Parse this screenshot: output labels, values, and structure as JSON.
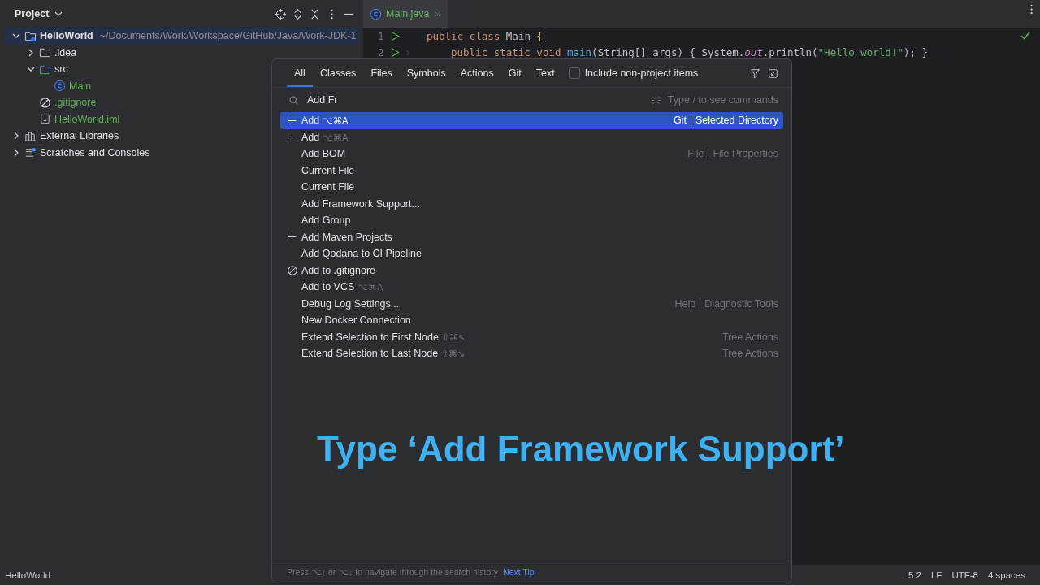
{
  "project_panel": {
    "title": "Project",
    "tree": [
      {
        "label": "HelloWorld",
        "detail": "~/Documents/Work/Workspace/GitHub/Java/Work-JDK-1",
        "kind": "module",
        "expanded": true,
        "selected": true,
        "added": false,
        "children": [
          {
            "label": ".idea",
            "kind": "folder",
            "expanded": false,
            "selected": false,
            "added": false
          },
          {
            "label": "src",
            "kind": "source",
            "expanded": true,
            "selected": false,
            "added": false,
            "children": [
              {
                "label": "Main",
                "kind": "class",
                "selected": false,
                "added": true
              }
            ]
          },
          {
            "label": ".gitignore",
            "kind": "ignore",
            "selected": false,
            "added": true
          },
          {
            "label": "HelloWorld.iml",
            "kind": "file",
            "selected": false,
            "added": true
          }
        ]
      },
      {
        "label": "External Libraries",
        "kind": "library",
        "expanded": false,
        "selected": false,
        "added": false
      },
      {
        "label": "Scratches and Consoles",
        "kind": "scratch",
        "expanded": false,
        "selected": false,
        "added": false
      }
    ]
  },
  "editor": {
    "tab": {
      "label": "Main.java",
      "selected": true
    },
    "lines": [
      {
        "number": "1",
        "runnable": true,
        "foldable": false,
        "tokens": [
          {
            "kind": "keyword",
            "text": "public class "
          },
          {
            "kind": "plain",
            "text": "Main "
          },
          {
            "kind": "brace",
            "text": "{"
          }
        ],
        "children": [
          {
            "number": "2",
            "runnable": true,
            "foldable": true,
            "tokens": [
              {
                "kind": "keyword",
                "text": "public static void "
              },
              {
                "kind": "method",
                "text": "main"
              },
              {
                "kind": "plain",
                "text": "(String[] args) { System."
              },
              {
                "kind": "field",
                "text": "out"
              },
              {
                "kind": "plain",
                "text": ".println("
              },
              {
                "kind": "string",
                "text": "\"Hello world!\""
              },
              {
                "kind": "plain",
                "text": "); }"
              }
            ]
          }
        ]
      }
    ]
  },
  "search_popup": {
    "tabs": [
      {
        "label": "All",
        "selected": true
      },
      {
        "label": "Classes",
        "selected": false
      },
      {
        "label": "Files",
        "selected": false
      },
      {
        "label": "Symbols",
        "selected": false
      },
      {
        "label": "Actions",
        "selected": false
      },
      {
        "label": "Git",
        "selected": false
      },
      {
        "label": "Text",
        "selected": false
      }
    ],
    "include_non_project": {
      "label": "Include non-project items",
      "checked": false
    },
    "search": {
      "value": "Add Fr",
      "hint": "Type / to see commands"
    },
    "results": [
      {
        "kind": "plus",
        "label": "Add",
        "shortcut": "⌥⌘A",
        "category": [
          "Git",
          "Selected Directory"
        ],
        "selected": true
      },
      {
        "kind": "plus",
        "label": "Add",
        "shortcut": "⌥⌘A",
        "selected": false
      },
      {
        "kind": "plain",
        "label": "Add BOM",
        "category": [
          "File",
          "File Properties"
        ],
        "selected": false
      },
      {
        "kind": "plain",
        "label": "Current File",
        "selected": false
      },
      {
        "kind": "plain",
        "label": "Current File",
        "selected": false
      },
      {
        "kind": "plain",
        "label": "Add Framework Support...",
        "selected": false
      },
      {
        "kind": "plain",
        "label": "Add Group",
        "selected": false
      },
      {
        "kind": "plus",
        "label": "Add Maven Projects",
        "selected": false
      },
      {
        "kind": "plain",
        "label": "Add Qodana to CI Pipeline",
        "selected": false
      },
      {
        "kind": "ignore",
        "label": "Add to .gitignore",
        "selected": false
      },
      {
        "kind": "plain",
        "label": "Add to VCS",
        "shortcut": "⌥⌘A",
        "selected": false
      },
      {
        "kind": "plain",
        "label": "Debug Log Settings...",
        "category": [
          "Help",
          "Diagnostic Tools"
        ],
        "selected": false
      },
      {
        "kind": "plain",
        "label": "New Docker Connection",
        "selected": false
      },
      {
        "kind": "plain",
        "label": "Extend Selection to First Node",
        "shortcut": "⇧⌘↖",
        "category": [
          "Tree Actions"
        ],
        "selected": false
      },
      {
        "kind": "plain",
        "label": "Extend Selection to Last Node",
        "shortcut": "⇧⌘↘",
        "category": [
          "Tree Actions"
        ],
        "selected": false
      }
    ],
    "footer": {
      "text": "Press ⌥↑ or ⌥↓ to navigate through the search history",
      "link": "Next Tip"
    }
  },
  "caption": "Type ‘Add Framework Support’",
  "status_bar": {
    "project": "HelloWorld",
    "items": [
      "5:2",
      "LF",
      "UTF-8",
      "4 spaces"
    ]
  }
}
